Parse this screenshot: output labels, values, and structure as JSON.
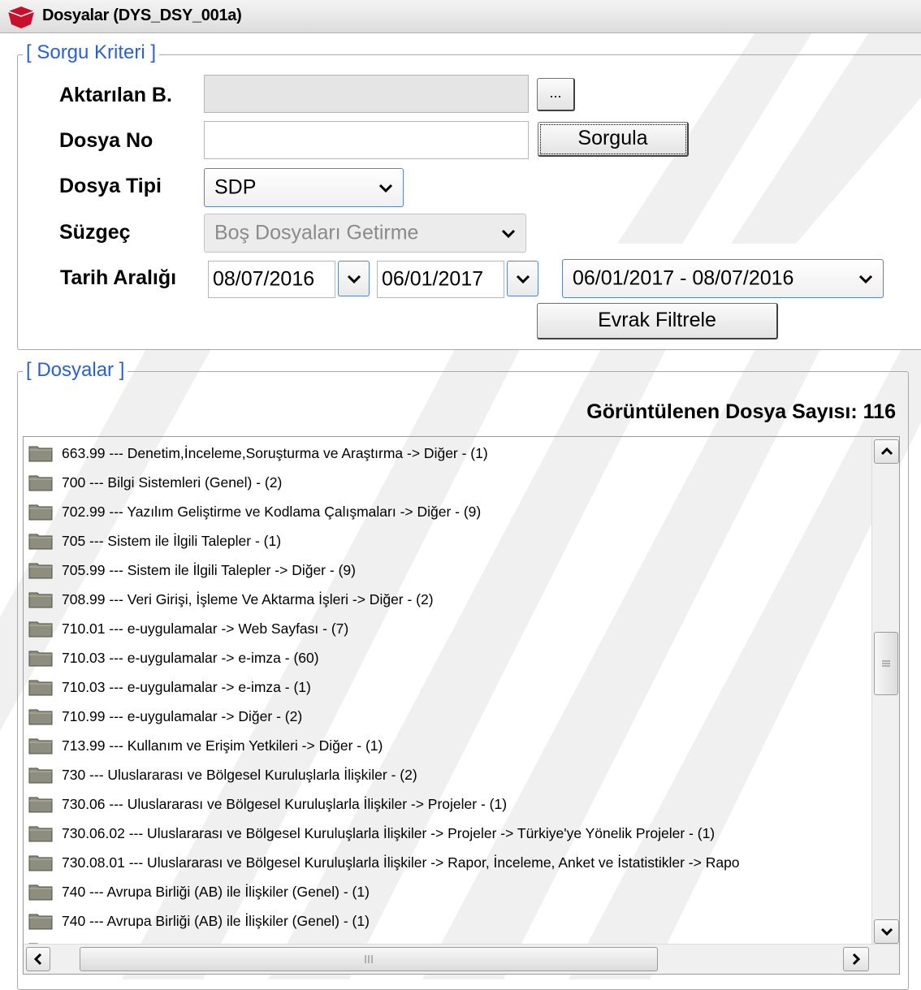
{
  "window": {
    "title": "Dosyalar (DYS_DSY_001a)",
    "icon": "red-shield-icon"
  },
  "query_section": {
    "legend": "[ Sorgu Kriteri ]",
    "aktarilan": {
      "label": "Aktarılan B.",
      "value": "",
      "browse_label": "..."
    },
    "dosya_no": {
      "label": "Dosya No",
      "value": "",
      "search_label": "Sorgula"
    },
    "dosya_tipi": {
      "label": "Dosya Tipi",
      "value": "SDP"
    },
    "suzgec": {
      "label": "Süzgeç",
      "value": "Boş Dosyaları Getirme"
    },
    "tarih": {
      "label": "Tarih Aralığı",
      "start": "08/07/2016",
      "end": "06/01/2017",
      "range": "06/01/2017 - 08/07/2016"
    },
    "filter_label": "Evrak Filtrele"
  },
  "files_section": {
    "legend": "[ Dosyalar ]",
    "count_text": "Görüntülenen Dosya Sayısı: 116",
    "items": [
      "663.99 --- Denetim,İnceleme,Soruşturma ve Araştırma -> Diğer - (1)",
      "700 --- Bilgi Sistemleri (Genel) - (2)",
      "702.99 --- Yazılım Geliştirme ve Kodlama Çalışmaları -> Diğer - (9)",
      "705 --- Sistem ile İlgili Talepler - (1)",
      "705.99 --- Sistem ile İlgili Talepler -> Diğer - (9)",
      "708.99 --- Veri Girişi, İşleme Ve Aktarma İşleri -> Diğer - (2)",
      "710.01 --- e-uygulamalar -> Web Sayfası  - (7)",
      "710.03 --- e-uygulamalar -> e-imza - (60)",
      "710.03 --- e-uygulamalar -> e-imza - (1)",
      "710.99 --- e-uygulamalar -> Diğer - (2)",
      "713.99 --- Kullanım ve Erişim Yetkileri -> Diğer - (1)",
      "730 --- Uluslararası ve Bölgesel Kuruluşlarla İlişkiler - (2)",
      "730.06 --- Uluslararası ve Bölgesel Kuruluşlarla İlişkiler -> Projeler - (1)",
      "730.06.02 --- Uluslararası ve Bölgesel Kuruluşlarla İlişkiler -> Projeler -> Türkiye'ye Yönelik Projeler - (1)",
      "730.08.01 --- Uluslararası ve Bölgesel Kuruluşlarla İlişkiler -> Rapor, İnceleme, Anket ve İstatistikler -> Rapo",
      "740 --- Avrupa Birliği (AB) ile İlişkiler (Genel) - (1)",
      "740 --- Avrupa Birliği (AB) ile İlişkiler (Genel) - (1)"
    ]
  },
  "colors": {
    "legend": "#2a5fd6",
    "folder": "#8c8c7c",
    "select_border": "#5a84c5"
  }
}
